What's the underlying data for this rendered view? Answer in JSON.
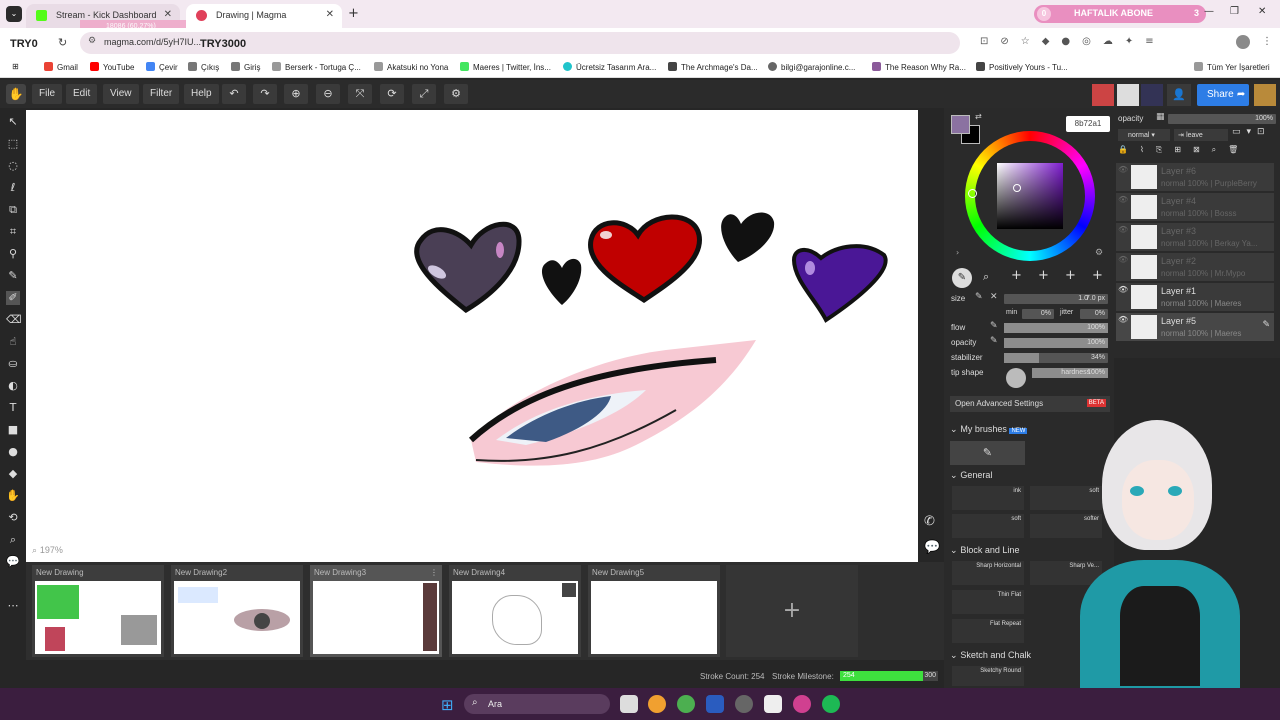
{
  "browser": {
    "tabs": [
      {
        "title": "Stream - Kick Dashboard",
        "active": false
      },
      {
        "title": "Drawing | Magma",
        "active": true
      }
    ],
    "overlay_subscriber_label": "HAFTALIK ABONE",
    "overlay_subscriber_count": "3",
    "overlay_left_count": "0",
    "url": "magma.com/d/5yH7IU...",
    "overlay_progress_text": "18086 (60.27%)",
    "overlay_name_left": "TRY0",
    "overlay_name_right": "TRY3000",
    "bookmarks": [
      "Gmail",
      "YouTube",
      "Çevir",
      "Çıkış",
      "Giriş",
      "Berserk - Tortuga Ç...",
      "Akatsuki no Yona",
      "Maeres | Twitter, İns...",
      "Ücretsiz Tasarım Ara...",
      "The Archmage's Da...",
      "bilgi@garajonline.c...",
      "The Reason Why Ra...",
      "Positively Yours - Tu..."
    ],
    "all_bookmarks": "Tüm Yer İşaretleri"
  },
  "menu": {
    "items": [
      "File",
      "Edit",
      "View",
      "Filter",
      "Help"
    ],
    "share_label": "Share"
  },
  "canvas": {
    "zoom": "197%"
  },
  "thumbnails": [
    "New Drawing",
    "New Drawing2",
    "New Drawing3",
    "New Drawing4",
    "New Drawing5"
  ],
  "status": {
    "stroke_count_label": "Stroke Count: 254",
    "stroke_milestone_label": "Stroke Milestone:",
    "milestone_value": "254",
    "milestone_max": "300",
    "milestone_fraction": 0.847
  },
  "color": {
    "hex": "8b72a1",
    "primary": "#8b72a1",
    "secondary": "#000000"
  },
  "brush_settings": {
    "size_label": "size",
    "size_value": "7.0 px",
    "size_field": "1.0",
    "min_label": "min",
    "min_value": "0%",
    "jitter_label": "jitter",
    "jitter_value": "0%",
    "flow_label": "flow",
    "flow_value": "100%",
    "opacity_label": "opacity",
    "opacity_value": "100%",
    "stabilizer_label": "stabilizer",
    "stabilizer_value": "34%",
    "stabilizer_fraction": 0.34,
    "tip_shape_label": "tip shape",
    "hardness_label": "hardness",
    "hardness_value": "100%",
    "advanced_label": "Open Advanced Settings",
    "beta": "BETA"
  },
  "brush_library": {
    "my_brushes": "My brushes",
    "new_badge": "NEW",
    "general": "General",
    "general_brushes": [
      "ink",
      "soft",
      "soft",
      "softer"
    ],
    "block_and_line": "Block and Line",
    "block_brushes": [
      "Sharp Horizontal",
      "Sharp Ve...",
      "Thin Flat",
      "Flat Repeat"
    ],
    "sketch_and_chalk": "Sketch and Chalk",
    "sketch_brushes": [
      "Sketchy Round"
    ]
  },
  "layers": {
    "opacity_label": "opacity",
    "opacity_value": "100%",
    "blend_mode": "normal",
    "leave_label": "leave",
    "items": [
      {
        "name": "Layer #6",
        "meta": "normal 100% | PurpleBerry",
        "dim": true
      },
      {
        "name": "Layer #4",
        "meta": "normal 100% | Bosss",
        "dim": true
      },
      {
        "name": "Layer #3",
        "meta": "normal 100% | Berkay Ya...",
        "dim": true
      },
      {
        "name": "Layer #2",
        "meta": "normal 100% | Mr.Mypo",
        "dim": true
      },
      {
        "name": "Layer #1",
        "meta": "normal 100% | Maeres",
        "dim": false
      },
      {
        "name": "Layer #5",
        "meta": "normal 100% | Maeres",
        "dim": false
      }
    ]
  },
  "taskbar": {
    "search_label": "Ara"
  }
}
